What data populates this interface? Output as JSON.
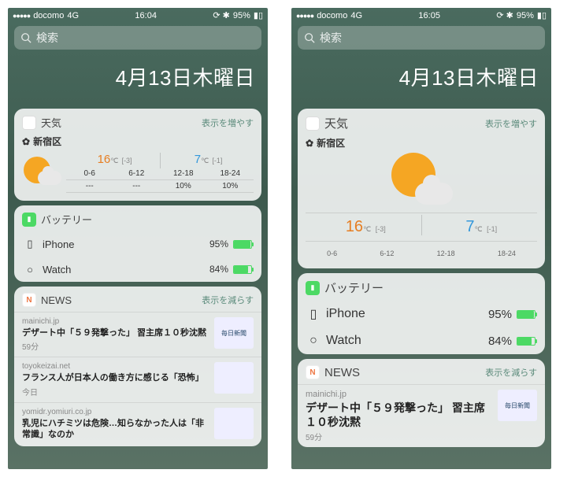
{
  "left": {
    "statusbar": {
      "carrier": "docomo",
      "net": "4G",
      "time": "16:04",
      "battery": "95%"
    },
    "search_placeholder": "検索",
    "date": "4月13日木曜日",
    "weather": {
      "title": "天気",
      "expand": "表示を増やす",
      "location": "新宿区",
      "high": "16",
      "high_unit": "℃",
      "high_diff": "[-3]",
      "low": "7",
      "low_unit": "℃",
      "low_diff": "[-1]",
      "slots": [
        "0-6",
        "6-12",
        "12-18",
        "18-24"
      ],
      "precip": [
        "---",
        "---",
        "10%",
        "10%"
      ]
    },
    "battery": {
      "title": "バッテリー",
      "devices": [
        {
          "name": "iPhone",
          "pct": "95%",
          "fill": 95
        },
        {
          "name": "Watch",
          "pct": "84%",
          "fill": 84
        }
      ]
    },
    "news": {
      "title": "NEWS",
      "expand": "表示を減らす",
      "items": [
        {
          "source": "mainichi.jp",
          "title": "デザート中「５９発撃った」 習主席１０秒沈黙",
          "time": "59分",
          "thumb": "毎日新聞"
        },
        {
          "source": "toyokeizai.net",
          "title": "フランス人が日本人の働き方に感じる「恐怖」",
          "time": "今日",
          "thumb": ""
        },
        {
          "source": "yomidr.yomiuri.co.jp",
          "title": "乳児にハチミツは危険…知らなかった人は「非常識」なのか",
          "time": "",
          "thumb": ""
        }
      ]
    }
  },
  "right": {
    "statusbar": {
      "carrier": "docomo",
      "net": "4G",
      "time": "16:05",
      "battery": "95%"
    },
    "search_placeholder": "検索",
    "date": "4月13日木曜日",
    "weather": {
      "title": "天気",
      "expand": "表示を増やす",
      "location": "新宿区",
      "high": "16",
      "high_unit": "℃",
      "high_diff": "[-3]",
      "low": "7",
      "low_unit": "℃",
      "low_diff": "[-1]",
      "slots": [
        "0-6",
        "6-12",
        "12-18",
        "18-24"
      ]
    },
    "battery": {
      "title": "バッテリー",
      "devices": [
        {
          "name": "iPhone",
          "pct": "95%",
          "fill": 95
        },
        {
          "name": "Watch",
          "pct": "84%",
          "fill": 84
        }
      ]
    },
    "news": {
      "title": "NEWS",
      "expand": "表示を減らす",
      "items": [
        {
          "source": "mainichi.jp",
          "title": "デザート中「５９発撃った」 習主席１０秒沈黙",
          "time": "59分",
          "thumb": "毎日新聞"
        }
      ]
    }
  }
}
